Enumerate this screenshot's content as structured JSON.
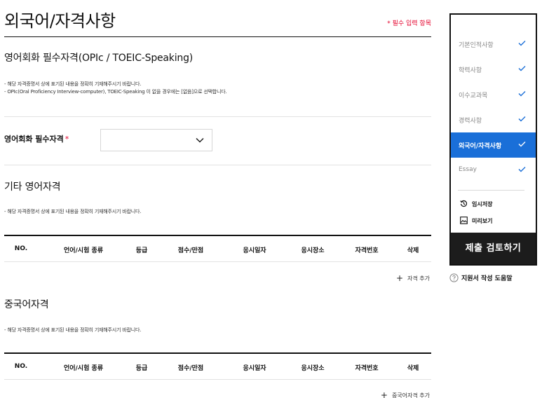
{
  "page": {
    "title": "외국어/자격사항",
    "required_note": "* 필수 입력 항목"
  },
  "sections": {
    "english_speaking": {
      "title": "영어회화 필수자격(OPIc / TOEIC-Speaking)",
      "notes": [
        "- 해당 자격증명서 상에 표기된 내용을 정확히 기재해주시기 바랍니다.",
        "- OPIc(Oral Proficiency Interview-computer), TOEIC-Speaking 이 없을 경우에는 [없음]으로 선택합니다."
      ],
      "field_label": "영어회화 필수자격",
      "required_mark": "*",
      "select_value": ""
    },
    "other_english": {
      "title": "기타 영어자격",
      "note": "- 해당 자격증명서 상에 표기된 내용을 정확히 기재해주시기 바랍니다.",
      "add_label": "자격 추가"
    },
    "chinese": {
      "title": "중국어자격",
      "note": "- 해당 자격증명서 상에 표기된 내용을 정확히 기재해주시기 바랍니다.",
      "add_label": "중국어자격 추가"
    }
  },
  "table_columns": [
    "NO.",
    "언어/시험 종류",
    "등급",
    "점수/만점",
    "응시일자",
    "응시장소",
    "자격번호",
    "삭제"
  ],
  "sidebar": {
    "items": [
      {
        "label": "기본인적사항",
        "checked": true
      },
      {
        "label": "학력사항",
        "checked": true
      },
      {
        "label": "이수교과목",
        "checked": true
      },
      {
        "label": "경력사항",
        "checked": true
      },
      {
        "label": "외국어/자격사항",
        "checked": true,
        "active": true
      },
      {
        "label": "Essay",
        "checked": true
      }
    ],
    "temp_save": "임시저장",
    "preview": "미리보기",
    "submit": "제출 검토하기"
  },
  "help": {
    "label": "지원서 작성 도움말"
  },
  "colors": {
    "accent": "#1a6fd8",
    "required": "#e4002b",
    "dark": "#1c1c1c",
    "check": "#1a6fd8"
  },
  "icons": [
    "chevron-down-icon",
    "check-icon",
    "save-history-icon",
    "preview-image-icon",
    "plus-icon",
    "help-circle-icon"
  ]
}
